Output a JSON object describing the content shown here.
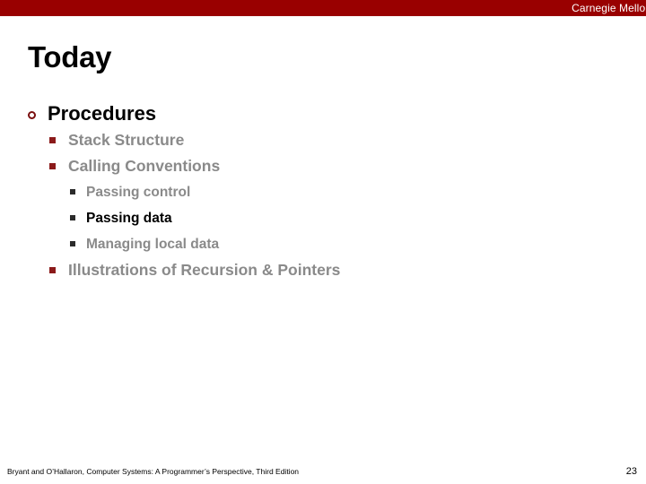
{
  "header": {
    "brand": "Carnegie Mellon",
    "bar_color": "#990000",
    "brand_color": "#ffffff"
  },
  "slide": {
    "title": "Today",
    "title_color": "#000000"
  },
  "outline": {
    "accent_color": "#8b1a1a",
    "dim_color": "#8a8a8a",
    "active_color": "#000000",
    "items": [
      {
        "level": 1,
        "text": "Procedures",
        "bullet": "open-circle-bullet",
        "state": "active"
      },
      {
        "level": 2,
        "text": "Stack Structure",
        "bullet": "square-bullet",
        "state": "dim"
      },
      {
        "level": 2,
        "text": "Calling Conventions",
        "bullet": "square-bullet",
        "state": "dim"
      },
      {
        "level": 3,
        "text": "Passing control",
        "bullet": "small-square-bullet",
        "state": "dim"
      },
      {
        "level": 3,
        "text": "Passing data",
        "bullet": "small-square-bullet",
        "state": "current"
      },
      {
        "level": 3,
        "text": "Managing local data",
        "bullet": "small-square-bullet",
        "state": "dim"
      },
      {
        "level": 2,
        "text": "Illustrations of Recursion & Pointers",
        "bullet": "square-bullet",
        "state": "dim"
      }
    ]
  },
  "footer": {
    "citation": "Bryant and O’Hallaron, Computer Systems: A Programmer’s Perspective, Third Edition",
    "page_number": "23"
  }
}
